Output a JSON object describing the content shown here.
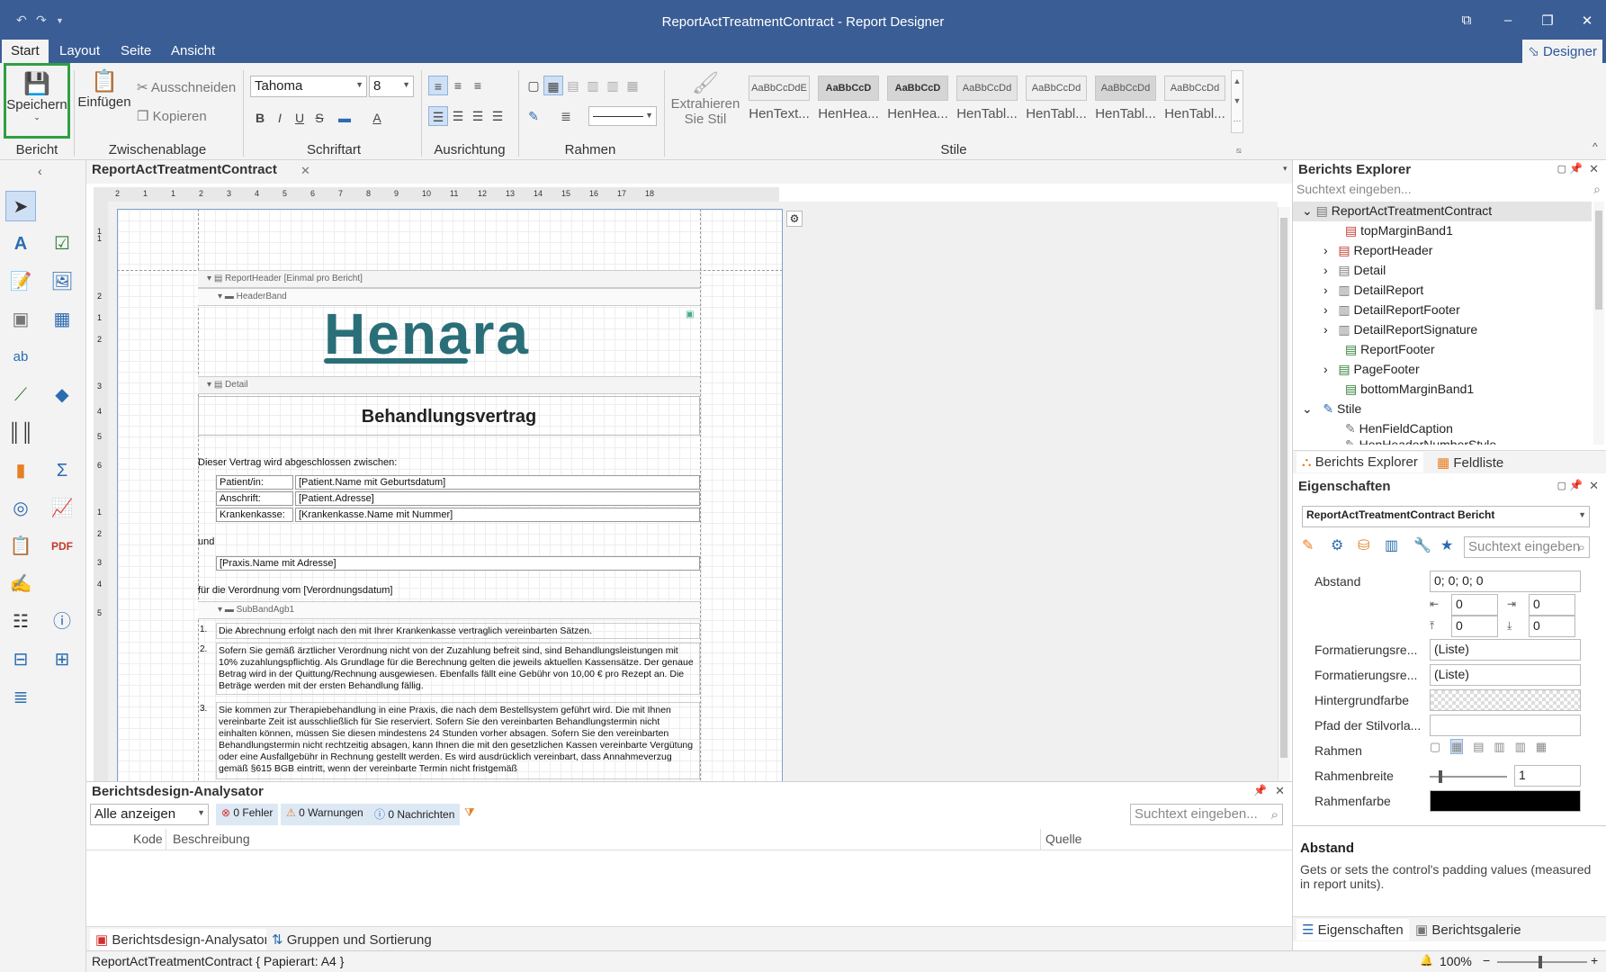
{
  "window": {
    "title": "ReportActTreatmentContract - Report Designer",
    "quick_access": [
      "undo-icon",
      "redo-icon",
      "dropdown-icon"
    ],
    "controls": [
      "restore-icon",
      "minimize-icon",
      "maximize-icon",
      "close-icon"
    ]
  },
  "menu": {
    "items": [
      "Start",
      "Layout",
      "Seite",
      "Ansicht"
    ],
    "designer_label": "Designer"
  },
  "ribbon": {
    "bericht": {
      "save_label": "Speichern",
      "group_label": "Bericht"
    },
    "clipboard": {
      "paste_label": "Einfügen",
      "cut_label": "Ausschneiden",
      "copy_label": "Kopieren",
      "group_label": "Zwischenablage"
    },
    "font": {
      "family": "Tahoma",
      "size": "8",
      "group_label": "Schriftart",
      "buttons": [
        "B",
        "I",
        "U",
        "S"
      ]
    },
    "alignment": {
      "group_label": "Ausrichtung"
    },
    "borders": {
      "group_label": "Rahmen"
    },
    "extract": {
      "label_line1": "Extrahieren",
      "label_line2": "Sie Stil"
    },
    "styles": {
      "group_label": "Stile",
      "tiles": [
        {
          "preview": "AaBbCcDdE",
          "name": "HenText..."
        },
        {
          "preview": "AaBbCcD",
          "name": "HenHea..."
        },
        {
          "preview": "AaBbCcD",
          "name": "HenHea..."
        },
        {
          "preview": "AaBbCcDd",
          "name": "HenTabl..."
        },
        {
          "preview": "AaBbCcDd",
          "name": "HenTabl..."
        },
        {
          "preview": "AaBbCcDd",
          "name": "HenTabl..."
        },
        {
          "preview": "AaBbCcDd",
          "name": "HenTabl..."
        }
      ]
    }
  },
  "document": {
    "tab_label": "ReportActTreatmentContract",
    "ruler_h": [
      "2",
      "1",
      "1",
      "2",
      "3",
      "4",
      "5",
      "6",
      "7",
      "8",
      "9",
      "10",
      "11",
      "12",
      "13",
      "14",
      "15",
      "16",
      "17",
      "18"
    ],
    "ruler_v": [
      "1",
      "1",
      "2",
      "1",
      "2",
      "3",
      "4",
      "5",
      "6",
      "1",
      "2",
      "3",
      "4",
      "5"
    ],
    "bands": {
      "report_header": "ReportHeader [Einmal pro Bericht]",
      "header_band": "HeaderBand",
      "detail": "Detail",
      "sub_band": "SubBandAgb1"
    },
    "logo_text": "Henara",
    "heading": "Behandlungsvertrag",
    "intro": "Dieser Vertrag wird abgeschlossen zwischen:",
    "rows": [
      {
        "label": "Patient/in:",
        "value": "[Patient.Name mit Geburtsdatum]"
      },
      {
        "label": "Anschrift:",
        "value": "[Patient.Adresse]"
      },
      {
        "label": "Krankenkasse:",
        "value": "[Krankenkasse.Name mit Nummer]"
      }
    ],
    "und": "und",
    "praxis": "[Praxis.Name mit Adresse]",
    "verordnung": "für die Verordnung vom [Verordnungsdatum]",
    "clauses": [
      {
        "num": "1.",
        "text": "Die Abrechnung erfolgt nach den mit Ihrer Krankenkasse vertraglich vereinbarten Sätzen."
      },
      {
        "num": "2.",
        "text": "Sofern Sie gemäß ärztlicher Verordnung nicht von der Zuzahlung befreit sind, sind Behandlungsleistungen mit 10% zuzahlungspflichtig. Als Grundlage für die Berechnung gelten die jeweils aktuellen Kassensätze. Der genaue Betrag wird in der Quittung/Rechnung ausgewiesen. Ebenfalls fällt eine Gebühr von 10,00 € pro Rezept an. Die Beträge werden mit der ersten Behandlung fällig."
      },
      {
        "num": "3.",
        "text": "Sie kommen zur Therapiebehandlung in eine Praxis, die nach dem Bestellsystem geführt wird. Die mit Ihnen vereinbarte Zeit ist ausschließlich für Sie reserviert. Sofern Sie den vereinbarten Behandlungstermin nicht einhalten können, müssen Sie diesen mindestens 24 Stunden vorher absagen. Sofern Sie den vereinbarten Behandlungstermin nicht rechtzeitig absagen, kann Ihnen die mit den gesetzlichen Kassen vereinbarte Vergütung oder eine Ausfallgebühr in Rechnung gestellt werden. Es wird ausdrücklich vereinbart, dass Annahmeverzug gemäß §615 BGB eintritt, wenn der vereinbarte Termin nicht fristgemäß"
      }
    ]
  },
  "explorer": {
    "title": "Berichts Explorer",
    "search_placeholder": "Suchtext eingeben...",
    "root": "ReportActTreatmentContract",
    "items": [
      "topMarginBand1",
      "ReportHeader",
      "Detail",
      "DetailReport",
      "DetailReportFooter",
      "DetailReportSignature",
      "ReportFooter",
      "PageFooter",
      "bottomMarginBand1"
    ],
    "styles_node": "Stile",
    "style_items": [
      "HenFieldCaption",
      "HenHeaderNumberStyle"
    ],
    "tab_explorer": "Berichts Explorer",
    "tab_fields": "Feldliste"
  },
  "properties": {
    "title": "Eigenschaften",
    "selector": "ReportActTreatmentContract  Bericht",
    "search_placeholder": "Suchtext eingeben",
    "abstand_label": "Abstand",
    "abstand_value": "0; 0; 0; 0",
    "padding_values": [
      "0",
      "0",
      "0",
      "0"
    ],
    "format1_label": "Formatierungsre...",
    "format1_value": "(Liste)",
    "format2_label": "Formatierungsre...",
    "format2_value": "(Liste)",
    "bg_label": "Hintergrundfarbe",
    "style_path_label": "Pfad der Stilvorla...",
    "rahmen_label": "Rahmen",
    "rahmenbreite_label": "Rahmenbreite",
    "rahmenbreite_value": "1",
    "rahmenfarbe_label": "Rahmenfarbe",
    "desc_title": "Abstand",
    "desc_text": "Gets or sets the control's padding values (measured in report units).",
    "tab_props": "Eigenschaften",
    "tab_gallery": "Berichtsgalerie"
  },
  "analyzer": {
    "title": "Berichtsdesign-Analysator",
    "filter": "Alle anzeigen",
    "errors": "0 Fehler",
    "warnings": "0 Warnungen",
    "messages": "0 Nachrichten",
    "search_placeholder": "Suchtext eingeben...",
    "columns": [
      "Kode",
      "Beschreibung",
      "Quelle"
    ],
    "tab_analyzer": "Berichtsdesign-Analysator",
    "tab_groups": "Gruppen und Sortierung"
  },
  "status": {
    "text": "ReportActTreatmentContract { Papierart: A4 }",
    "zoom": "100%"
  },
  "colors": {
    "titlebar": "#3a5d95",
    "accent": "#2b579a",
    "logo": "#2a6f78",
    "save_highlight": "#2ea043"
  }
}
